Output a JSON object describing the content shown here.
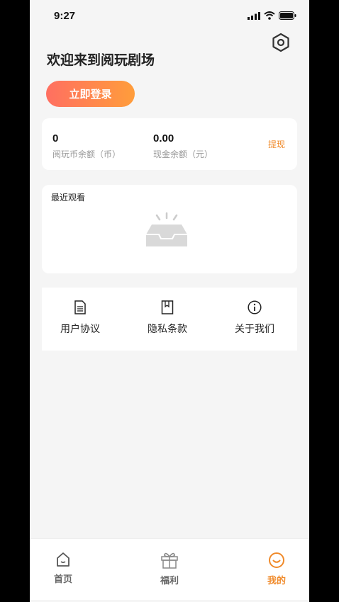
{
  "status_bar": {
    "time": "9:27"
  },
  "header": {
    "welcome": "欢迎来到阅玩剧场",
    "login_label": "立即登录"
  },
  "balance": {
    "coins_value": "0",
    "coins_label": "阅玩币余额（币）",
    "cash_value": "0.00",
    "cash_label": "现金余额（元）",
    "withdraw_label": "提现"
  },
  "recent": {
    "title": "最近观看"
  },
  "links": [
    {
      "label": "用户协议",
      "icon": "document-icon"
    },
    {
      "label": "隐私条款",
      "icon": "bookmark-icon"
    },
    {
      "label": "关于我们",
      "icon": "info-icon"
    }
  ],
  "tabs": [
    {
      "label": "首页",
      "icon": "home-icon"
    },
    {
      "label": "福利",
      "icon": "gift-icon"
    },
    {
      "label": "我的",
      "icon": "smile-icon",
      "active": true
    }
  ],
  "colors": {
    "accent": "#f08a2a",
    "gradient_start": "#ff6f61",
    "gradient_end": "#ff9d3b"
  }
}
